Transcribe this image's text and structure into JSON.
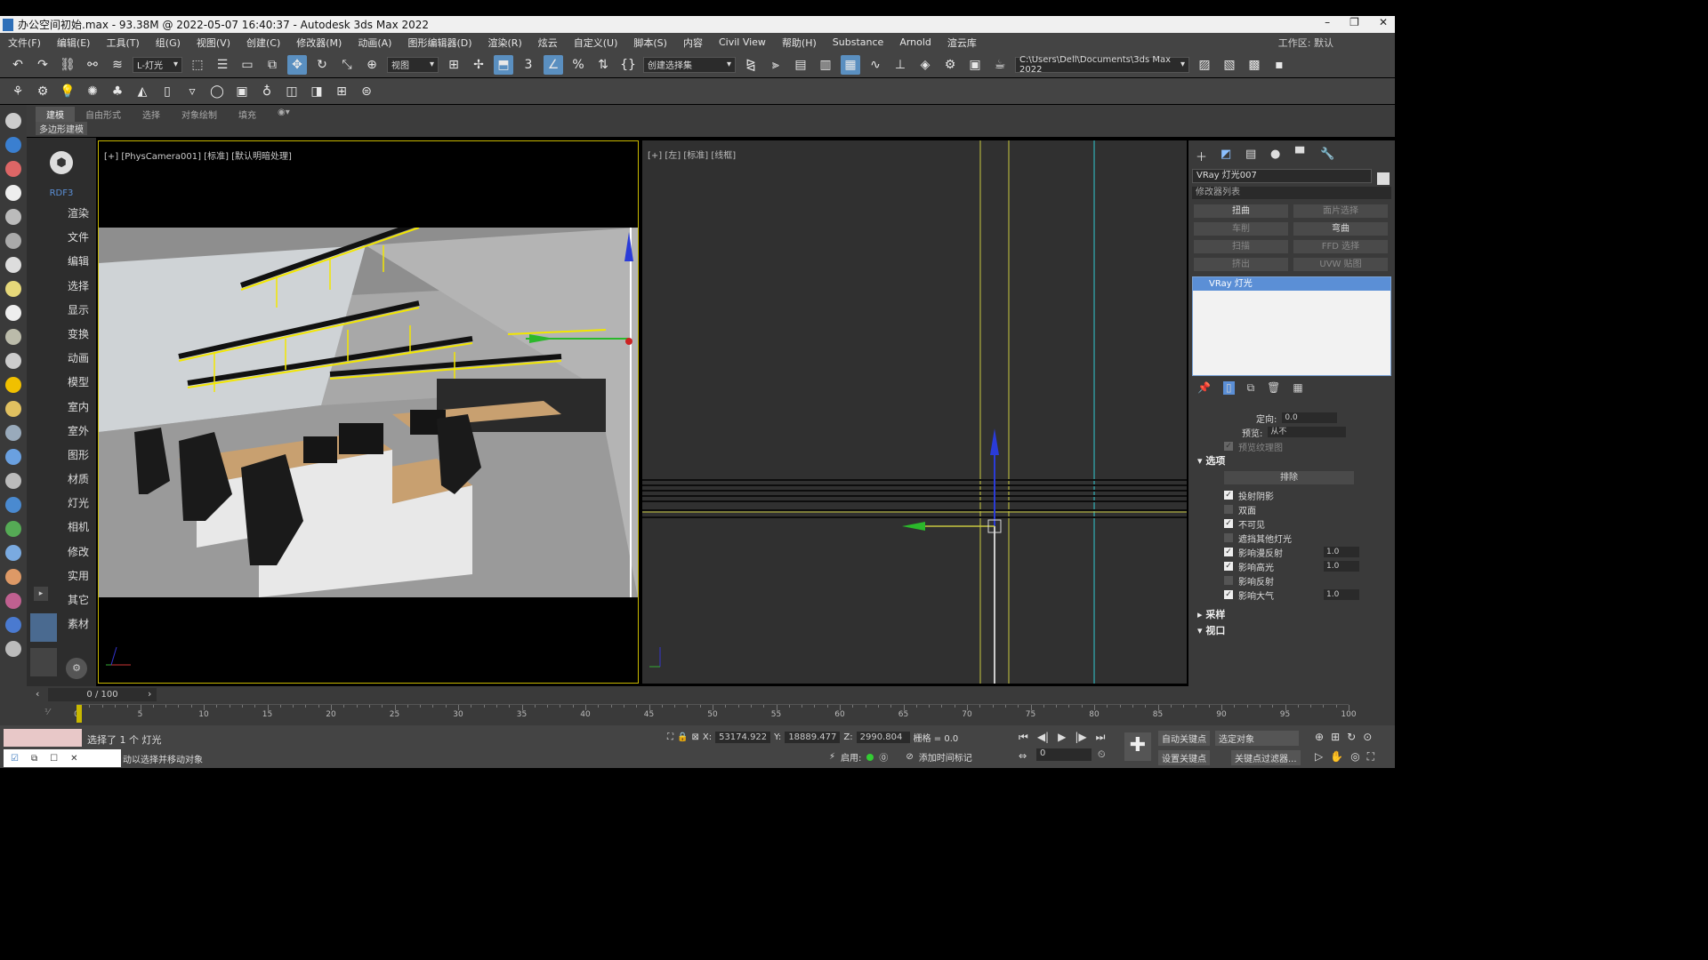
{
  "window": {
    "title": "办公空间初始.max - 93.38M @ 2022-05-07 16:40:37 - Autodesk 3ds Max 2022"
  },
  "menu": [
    "文件(F)",
    "编辑(E)",
    "工具(T)",
    "组(G)",
    "视图(V)",
    "创建(C)",
    "修改器(M)",
    "动画(A)",
    "图形编辑器(D)",
    "渲染(R)",
    "炫云",
    "自定义(U)",
    "脚本(S)",
    "内容",
    "Civil View",
    "帮助(H)",
    "Substance",
    "Arnold",
    "渲云库"
  ],
  "menu_right": "工作区: 默认",
  "toolbar": {
    "filter_dropdown": "L-灯光",
    "view_dropdown": "视图",
    "selection_set": "创建选择集",
    "path": "C:\\Users\\Dell\\Documents\\3ds Max 2022"
  },
  "ribbon": {
    "tabs": [
      "建模",
      "自由形式",
      "选择",
      "对象绘制",
      "填充"
    ],
    "sub_label": "多边形建模"
  },
  "scene_panel": {
    "header": "RDF3",
    "items": [
      "渲染",
      "文件",
      "编辑",
      "选择",
      "显示",
      "变换",
      "动画",
      "模型",
      "室内",
      "室外",
      "图形",
      "材质",
      "灯光",
      "相机",
      "修改",
      "实用",
      "其它",
      "素材"
    ]
  },
  "viewport_left": {
    "label": "[+] [PhysCamera001] [标准] [默认明暗处理]"
  },
  "viewport_right": {
    "label": "[+] [左] [标准] [线框]"
  },
  "command_panel": {
    "object_name": "VRay 灯光007",
    "modifier_list": "修改器列表",
    "mod_buttons": [
      {
        "label": "扭曲",
        "on": true
      },
      {
        "label": "面片选择",
        "on": false
      },
      {
        "label": "车削",
        "on": false
      },
      {
        "label": "弯曲",
        "on": true
      },
      {
        "label": "扫描",
        "on": false
      },
      {
        "label": "FFD 选择",
        "on": false
      },
      {
        "label": "挤出",
        "on": false
      },
      {
        "label": "UVW 贴图",
        "on": false
      }
    ],
    "stack_item": "VRay 灯光",
    "direction_label": "定向:",
    "direction_value": "0.0",
    "preview_label": "预览:",
    "preview_value": "从不",
    "preview_texture": "预览纹理图",
    "options_header": "选项",
    "exclude_button": "排除",
    "options": [
      {
        "label": "投射阴影",
        "checked": true,
        "value": ""
      },
      {
        "label": "双面",
        "checked": false,
        "value": ""
      },
      {
        "label": "不可见",
        "checked": true,
        "value": ""
      },
      {
        "label": "遮挡其他灯光",
        "checked": false,
        "value": ""
      },
      {
        "label": "影响漫反射",
        "checked": true,
        "value": "1.0"
      },
      {
        "label": "影响高光",
        "checked": true,
        "value": "1.0"
      },
      {
        "label": "影响反射",
        "checked": false,
        "value": ""
      },
      {
        "label": "影响大气",
        "checked": true,
        "value": "1.0"
      }
    ],
    "sampling_header": "采样",
    "viewport_header": "视口"
  },
  "timeline": {
    "slider": "0 / 100",
    "ticks": [
      "0",
      "5",
      "10",
      "15",
      "20",
      "25",
      "30",
      "35",
      "40",
      "45",
      "50",
      "55",
      "60",
      "65",
      "70",
      "75",
      "80",
      "85",
      "90",
      "95",
      "100"
    ]
  },
  "status": {
    "selection": "选择了 1 个 灯光",
    "hint": "动以选择并移动对象",
    "x_label": "X:",
    "x": "53174.922",
    "y_label": "Y:",
    "y": "18889.477",
    "z_label": "Z:",
    "z": "2990.804",
    "grid": "栅格 = 0.0",
    "enable": "启用:",
    "add_time_tag": "添加时间标记",
    "auto_key": "自动关键点",
    "selected_object": "选定对象",
    "set_key": "设置关键点",
    "key_filter": "关键点过滤器...",
    "frame": "0"
  },
  "colors": {
    "bg_dark": "#303030",
    "viewport_active_border": "#c8b800",
    "selection_blue": "#5b8fd6",
    "light_yellow": "#f2e600"
  }
}
